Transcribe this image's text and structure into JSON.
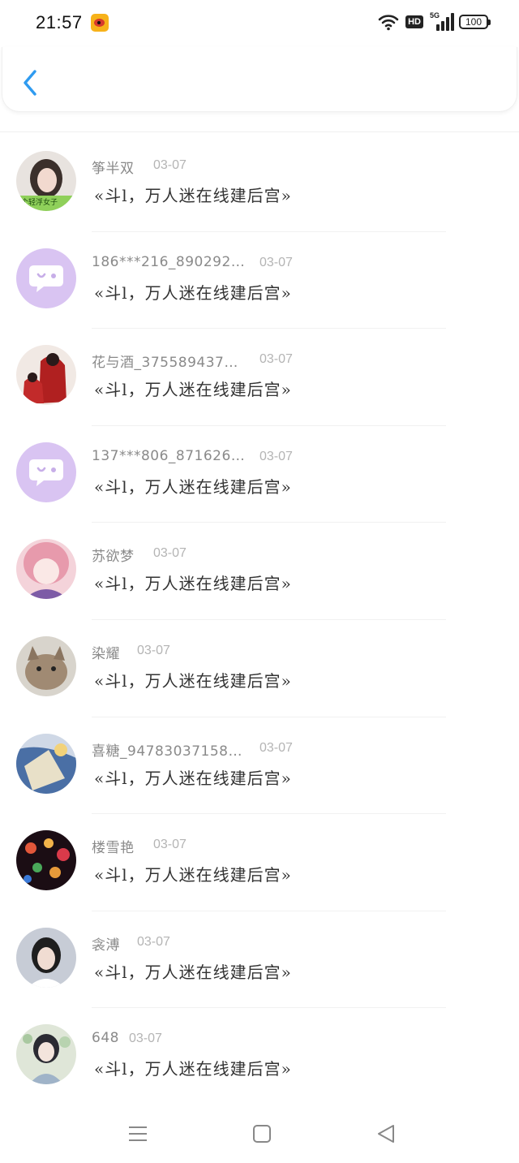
{
  "status_bar": {
    "time": "21:57",
    "network": "5G",
    "hd": "HD",
    "battery": "100"
  },
  "colors": {
    "accent": "#2f9bf0",
    "chat_avatar_bg": "#d9c4f2",
    "chat_avatar_icon": "#ffffff"
  },
  "contacts": [
    {
      "name": "筝半双",
      "date": "03-07",
      "message": "«斗l，万人迷在线建后宫»",
      "avatar": "photo-girl-badge",
      "badge": "个轻浮女子"
    },
    {
      "name": "186***216_890292…",
      "date": "03-07",
      "message": "«斗l，万人迷在线建后宫»",
      "avatar": "chat-bubble-icon"
    },
    {
      "name": "花与酒_375589437…",
      "date": "03-07",
      "message": "«斗l，万人迷在线建后宫»",
      "avatar": "photo-red-figures"
    },
    {
      "name": "137***806_871626…",
      "date": "03-07",
      "message": "«斗l，万人迷在线建后宫»",
      "avatar": "chat-bubble-icon"
    },
    {
      "name": "苏欲梦",
      "date": "03-07",
      "message": "«斗l，万人迷在线建后宫»",
      "avatar": "photo-anime-pink"
    },
    {
      "name": "染耀",
      "date": "03-07",
      "message": "«斗l，万人迷在线建后宫»",
      "avatar": "photo-kitten"
    },
    {
      "name": "喜糖_94783037158…",
      "date": "03-07",
      "message": "«斗l，万人迷在线建后宫»",
      "avatar": "photo-blue-art"
    },
    {
      "name": "楼雪艳",
      "date": "03-07",
      "message": "«斗l，万人迷在线建后宫»",
      "avatar": "photo-bokeh-lights"
    },
    {
      "name": "衾溥",
      "date": "03-07",
      "message": "«斗l，万人迷在线建后宫»",
      "avatar": "photo-girl-portrait"
    },
    {
      "name": "648",
      "date": "03-07",
      "message": "«斗l，万人迷在线建后宫»",
      "avatar": "photo-anime-girl-flowers"
    }
  ],
  "nav": {
    "menu_icon": "menu-icon",
    "home_icon": "home-icon",
    "back_icon": "back-triangle-icon"
  }
}
